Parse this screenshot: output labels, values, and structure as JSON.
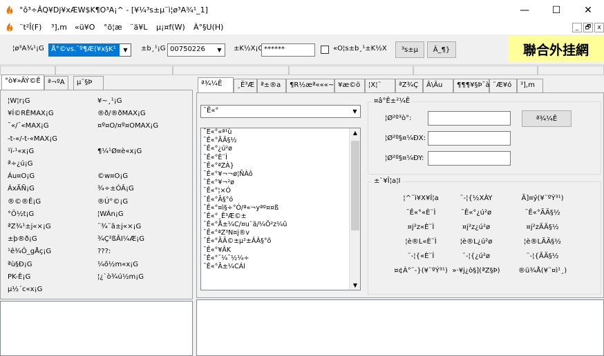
{
  "window": {
    "title": "°ô³÷ÂQ¥Dj¥xÆW$K¶O³A¡^ - [¥¼³s±µ¨ì¦ø³A¾¹_1]",
    "min": "—",
    "max": "☐",
    "close": "✕"
  },
  "menu": {
    "items": [
      "¨t²Î(F)",
      "³],m",
      "«ü¥O",
      "°õ¦æ",
      "¨ä¥L",
      "µ¡¤f(W)",
      "À°§U(H)"
    ],
    "mdi": [
      "_",
      "🗗",
      "x"
    ]
  },
  "toolbar": {
    "server_label": "¦ø³A¾¹¡G",
    "server_value": "Å°©vs.¯º¶Æ(¥x§K¹",
    "account_label": "±b¸¹¡G",
    "account_value": "00750226",
    "password_label": "±K½X¡G",
    "password_value": "******",
    "checkbox_label": "«O¦s±b¸¹±K½X",
    "connect_label": "³s±µ",
    "help_label": "Â_¶}",
    "brand_text": "聯合外挂網"
  },
  "left_panel": {
    "tabs": [
      "°ò¥»ÄÝ©Ê",
      "ª¬ºA",
      "µ¨§Þ"
    ],
    "active_tab": 0,
    "col1": [
      "¦W¦r¡G",
      "¥Í©R­ÈMAX¡G",
      "¯«/¯«MAX¡G",
      "-t-«/-t-«MAX¡G",
      "¹ï-¹«x¡G",
      "ª÷¿ú¡G",
      "Áu¤O¡G",
      "ÁxÃÑ¡G",
      "®©®Ê¡G",
      "°Ô½t¡G",
      "ªZ¾¹±j«×¡G",
      "±þ®ð¡G",
      "¹ê¾Ô_gÅç¡G",
      "ªù§Ð¡G",
      "PK-È¡G",
      "µ½´c«x¡G"
    ],
    "col2": [
      "¥~¸¹¡G",
      "®ð/®ðMAX¡G",
      "¤º¤O/¤º¤OMAX¡G",
      "",
      "¶¼¹Ø¤è«x¡G",
      "",
      "©w¤O¡G",
      "¾÷±ÓÂ¡G",
      "®Ú°©¡G",
      "¦WÁn¡G",
      "¨¾¨ã±j«×¡G",
      "¾Ç²ßÂI¼Æ¡G",
      "???:",
      "¼ô½m«x¡G",
      "¦¿`ò¾ú½m¡G"
    ]
  },
  "right_panel": {
    "tabs": [
      "ª¾¼Ê",
      "¸Ë³Æ",
      "ª±®a",
      "¶R½æª«««~",
      "¥æ©ö",
      "¦X¦¨",
      "ªZ¾Ç",
      "Â\\Âu",
      "¶¶¶¥§Þ¯à",
      "¨Æ¥ó",
      "³],m"
    ],
    "active_tab": 0,
    "dropdown_value": "¯Ê«°",
    "list": [
      "¯Ê«°«ª¹ù",
      "¯Ê«°ÃÄ§½",
      "¯Ê«°¿ú²ø",
      "¯Ê«°È¨Ì",
      "¯Ê«°ªZÀ}",
      "¯Ê«°¥¬¬ø¦ÑÀô",
      "¯Ê«°¥¬²ø",
      "¯Ê«°¦×Ó",
      "¯Ê«°Ã§°ó",
      "¯Ê«°¤ì§÷°Ó/ª«¬yªº¤¤ß",
      "¯Ê«°¸Ê³Æ©±",
      "¯Ê«°Å±¼C/¤u¨ã/¼Ö²z¼û",
      "¯Ê«°ªZ³N¤j®v",
      "¯Ê«°ÃÄ©±µ²±ÂÂ§°ô",
      "¯Ê«°¥ÂK",
      "¯Ê«°¯¼¯½¼÷",
      "¯Ê«°Ã±¼CÁl"
    ],
    "info_group": {
      "title": "¤â°Ê±²¼Ê",
      "fields": [
        "¦Ø²º³ò°:",
        "¦Ø²º§¤¼ÐX:",
        "¦Ø²º§¤¼ÐY:"
      ],
      "button": "ª¾¼Ê"
    },
    "action_group": {
      "title": "±`¥Î¦a¦I",
      "rows": [
        [
          "¦^¨ì¥X¥Í¦a",
          "¨-¦{½XÀY",
          "Ã]¤ý(¥¨ºÝ³¹)"
        ],
        [
          "¯Ê«°«È¨Ì",
          "¯Ê«°¿ú²ø",
          "¯Ê«°ÃÄ§½"
        ],
        [
          "¤j²z«È¨Ì",
          "¤j²z¿ú²ø",
          "¤j²zÃÄ§½"
        ],
        [
          "¦è®L«È¨Ì",
          "¦è®L¿ú²ø",
          "¦è®LÃÄ§½"
        ],
        [
          "¨-¦{«È¨Ì",
          "¨-¦{¿ú²ø",
          "¨-¦{ÃÄ§½"
        ],
        [
          "¤¢À°¨-}(¥¨ºÝ³¹)",
          "»·¥j¿ò§](ªZ§Þ)",
          "®ü¾Å(¥¨¤ì¹¸)"
        ]
      ]
    }
  }
}
